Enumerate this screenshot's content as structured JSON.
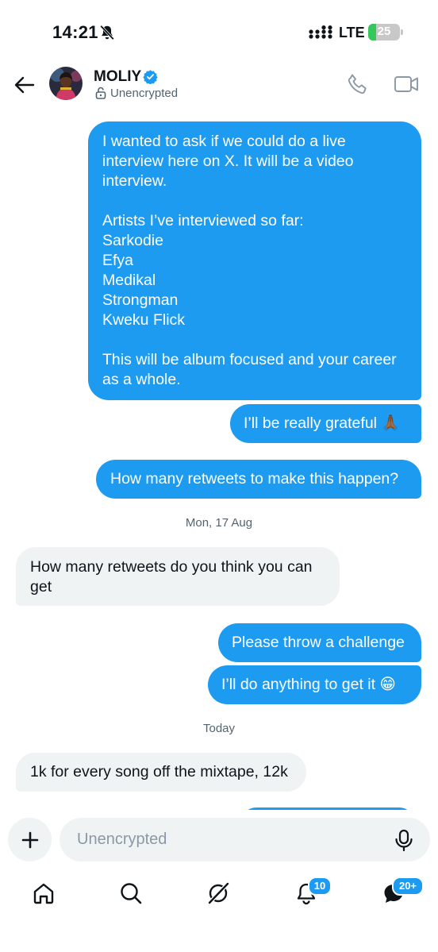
{
  "status_bar": {
    "time": "14:21",
    "network": "LTE",
    "battery_level": "25",
    "battery_fraction": 0.25
  },
  "header": {
    "contact_name": "MOLIY",
    "encryption_status": "Unencrypted"
  },
  "messages": [
    {
      "direction": "outgoing",
      "text": "I wanted to ask if we could do a live\ninterview here on X. It will be a video\ninterview.\n\nArtists I’ve interviewed so far:\nSarkodie\nEfya\nMedikal\nStrongman\nKweku Flick\n\nThis will be album focused and your career\nas a whole."
    },
    {
      "direction": "outgoing",
      "text": "I’ll be really grateful 🙏🏾"
    },
    {
      "direction": "outgoing",
      "text": "How many retweets to make this happen?"
    },
    {
      "direction": "separator",
      "text": "Mon, 17 Aug"
    },
    {
      "direction": "incoming",
      "text": "How many retweets do you think you can\nget"
    },
    {
      "direction": "outgoing",
      "text": "Please throw a challenge"
    },
    {
      "direction": "outgoing",
      "text": "I’ll do anything to get it 😁"
    },
    {
      "direction": "separator",
      "text": "Today"
    },
    {
      "direction": "incoming",
      "text": "1k for every song off the mixtape, 12k"
    }
  ],
  "composer": {
    "placeholder": "Unencrypted"
  },
  "tab_bar": {
    "notifications_badge": "10",
    "messages_badge": "20+"
  },
  "colors": {
    "accent": "#1d9bf0",
    "incoming_bubble": "#eff3f4",
    "battery_green": "#34c759"
  }
}
